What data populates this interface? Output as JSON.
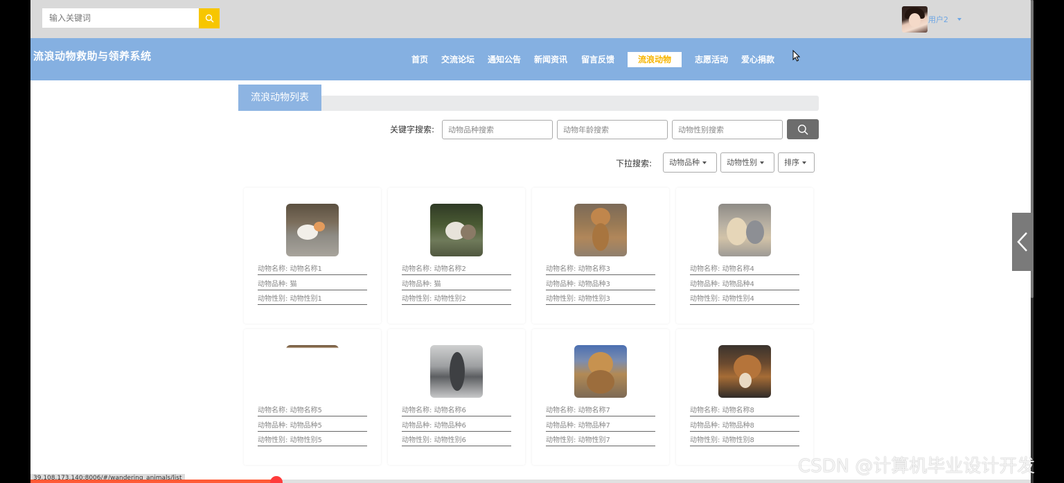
{
  "topbar": {
    "search_placeholder": "输入关键词",
    "username": "用户2"
  },
  "nav": {
    "site_title": "流浪动物救助与领养系统",
    "items": [
      "首页",
      "交流论坛",
      "通知公告",
      "新闻资讯",
      "留言反馈",
      "流浪动物",
      "志愿活动",
      "爱心捐款"
    ],
    "active": "流浪动物"
  },
  "section": {
    "title": "流浪动物列表"
  },
  "filters": {
    "keyword_label": "关键字搜索:",
    "species_placeholder": "动物品种搜索",
    "age_placeholder": "动物年龄搜索",
    "gender_placeholder": "动物性别搜索",
    "dropdown_label": "下拉搜索:",
    "dropdowns": [
      "动物品种",
      "动物性别",
      "排序"
    ]
  },
  "cards": [
    {
      "name": "动物名称: 动物名称1",
      "species": "动物品种: 猫",
      "gender": "动物性别: 动物性别1"
    },
    {
      "name": "动物名称: 动物名称2",
      "species": "动物品种: 猫",
      "gender": "动物性别: 动物性别2"
    },
    {
      "name": "动物名称: 动物名称3",
      "species": "动物品种: 动物品种3",
      "gender": "动物性别: 动物性别3"
    },
    {
      "name": "动物名称: 动物名称4",
      "species": "动物品种: 动物品种4",
      "gender": "动物性别: 动物性别4"
    },
    {
      "name": "动物名称: 动物名称5",
      "species": "动物品种: 动物品种5",
      "gender": "动物性别: 动物性别5"
    },
    {
      "name": "动物名称: 动物名称6",
      "species": "动物品种: 动物品种6",
      "gender": "动物性别: 动物性别6"
    },
    {
      "name": "动物名称: 动物名称7",
      "species": "动物品种: 动物品种7",
      "gender": "动物性别: 动物性别7"
    },
    {
      "name": "动物名称: 动物名称8",
      "species": "动物品种: 动物品种8",
      "gender": "动物性别: 动物性别8"
    }
  ],
  "status_url": "39.108.173.140:8006/#/wandering_animals/list",
  "watermark": "CSDN @计算机毕业设计开发",
  "colors": {
    "nav_bg": "#85b0e1",
    "accent": "#f7c600",
    "active_text": "#f7b500"
  }
}
